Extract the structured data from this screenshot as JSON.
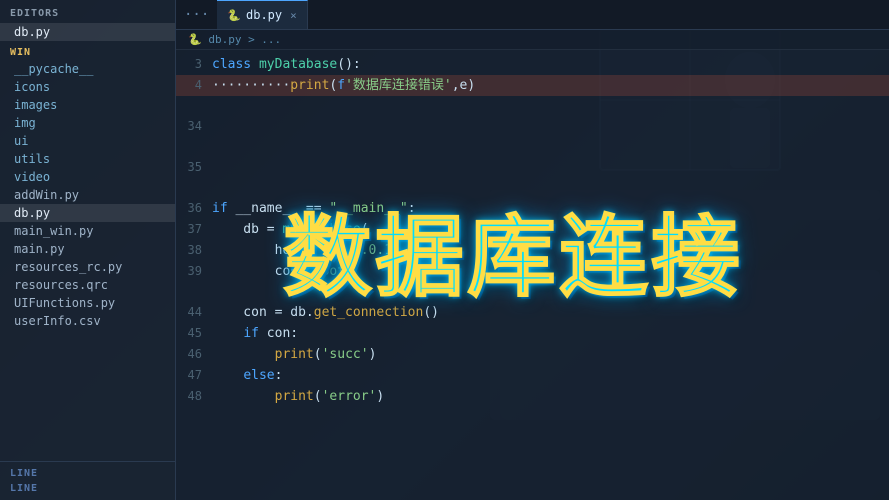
{
  "sidebar": {
    "editors_label": "EDITORS",
    "win_label": "WIN",
    "editors_items": [
      {
        "name": "db.py",
        "active": true,
        "type": "file"
      }
    ],
    "win_items": [
      {
        "name": "__pycache__",
        "type": "folder"
      },
      {
        "name": "icons",
        "type": "folder"
      },
      {
        "name": "images",
        "type": "folder"
      },
      {
        "name": "img",
        "type": "folder"
      },
      {
        "name": "ui",
        "type": "folder"
      },
      {
        "name": "utils",
        "type": "folder"
      },
      {
        "name": "video",
        "type": "folder"
      },
      {
        "name": "addWin.py",
        "type": "file"
      },
      {
        "name": "db.py",
        "active": true,
        "type": "file"
      },
      {
        "name": "main_win.py",
        "type": "file"
      },
      {
        "name": "main.py",
        "type": "file"
      },
      {
        "name": "resources_rc.py",
        "type": "file"
      },
      {
        "name": "resources.qrc",
        "type": "file"
      },
      {
        "name": "UIFunctions.py",
        "type": "file"
      },
      {
        "name": "userInfo.csv",
        "type": "file"
      }
    ],
    "bottom_items": [
      {
        "label": "LINE"
      },
      {
        "label": "LINE"
      }
    ]
  },
  "tabs": [
    {
      "label": "db.py",
      "active": true,
      "icon": "🐍"
    }
  ],
  "tab_more": "···",
  "breadcrumb": {
    "path": "db.py > ..."
  },
  "code": {
    "lines": [
      {
        "num": "3",
        "content": "class myDatabase():",
        "highlight": false
      },
      {
        "num": "4",
        "content": "        print(f'数据库连接错误',e)",
        "highlight": true
      },
      {
        "num": "",
        "content": "",
        "highlight": false
      },
      {
        "num": "34",
        "content": "",
        "highlight": false
      },
      {
        "num": "",
        "content": "",
        "highlight": false
      },
      {
        "num": "35",
        "content": "",
        "highlight": false
      },
      {
        "num": "",
        "content": "",
        "highlight": false
      },
      {
        "num": "36",
        "content": "if __name__ == \"__main__\":",
        "highlight": false
      },
      {
        "num": "37",
        "content": "    db = myDatabase(",
        "highlight": false
      },
      {
        "num": "38",
        "content": "        host='127.0.0.1',",
        "highlight": false
      },
      {
        "num": "39",
        "content": "        con='root'",
        "highlight": false
      },
      {
        "num": "",
        "content": "",
        "highlight": false
      },
      {
        "num": "44",
        "content": "    con = db.get_connection()",
        "highlight": false
      },
      {
        "num": "45",
        "content": "    if con:",
        "highlight": false
      },
      {
        "num": "46",
        "content": "        print('succ')",
        "highlight": false
      },
      {
        "num": "47",
        "content": "    else:",
        "highlight": false
      },
      {
        "num": "48",
        "content": "        print('error')",
        "highlight": false
      }
    ]
  },
  "big_title": {
    "text": "数据库连接"
  },
  "status": {
    "left": "LINE",
    "right": "LINE"
  }
}
